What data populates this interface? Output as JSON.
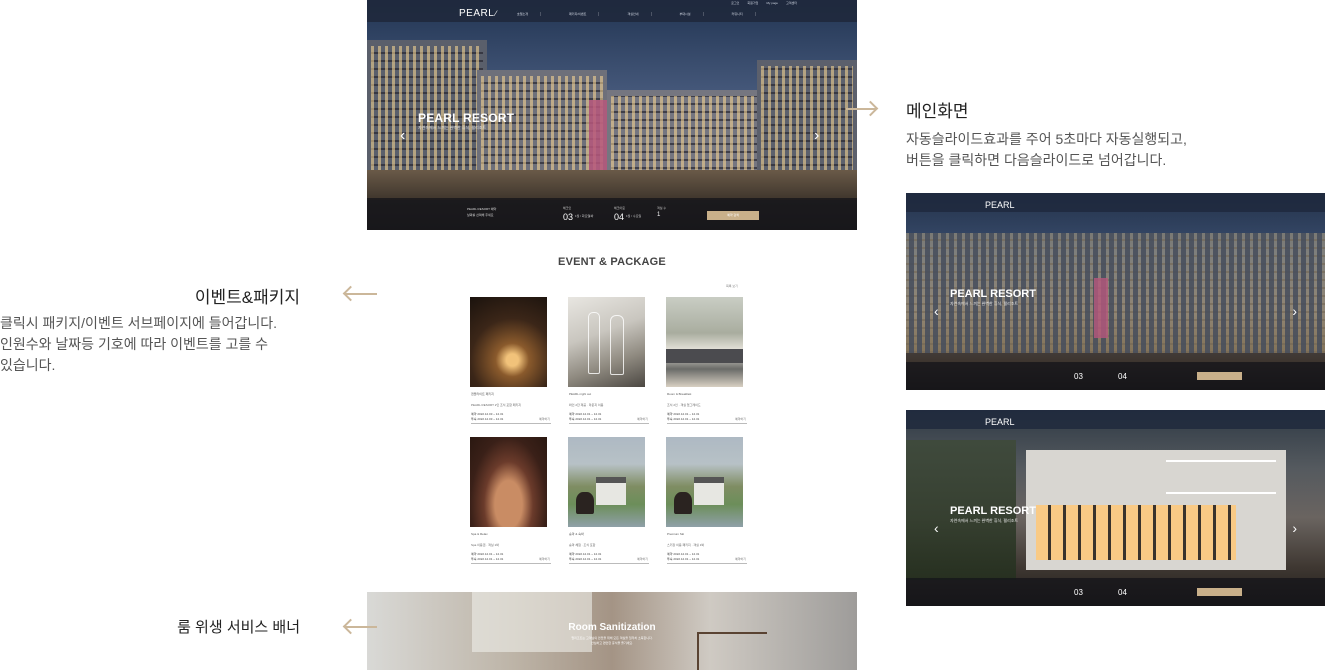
{
  "site": {
    "util_links": [
      "로그인",
      "회원가입",
      "My page",
      "고객센터"
    ],
    "logo": "PEARL",
    "gnb": [
      "호텔소개",
      "패키지/이벤트",
      "객실안내",
      "부대시설",
      "커뮤니티"
    ],
    "hero": {
      "title": "PEARL RESORT",
      "subtitle": "자연속에서 느끼는 완벽한 휴식, 펄리조트",
      "prev": "‹",
      "next": "›"
    },
    "booking": {
      "info_line1": "PEARL RESORT 예약",
      "info_line2": "날짜를 선택해 주세요",
      "checkin_label": "체크인",
      "checkin_day": "03",
      "checkin_meta": "1월 / 화요일",
      "nights": "1박",
      "checkout_label": "체크아웃",
      "checkout_day": "04",
      "checkout_meta": "1월 / 수요일",
      "guest_label": "객실 수",
      "guests": "1",
      "search_button": "예약 검색"
    },
    "events": {
      "title": "EVENT & PACKAGE",
      "more": "목록 보기",
      "cards": [
        {
          "name": "캔들라이트 패키지",
          "desc": "PEARL RESORT 2인 조식 포함 패키지",
          "period1": "예약 2022.12.03 ~ 12.31",
          "period2": "투숙 2022.12.03 ~ 12.31",
          "more": "예약하기"
        },
        {
          "name": "PEARL night out",
          "desc": "와인 2잔 제공 · 라운지 이용",
          "period1": "예약 2022.12.01 ~ 12.31",
          "period2": "투숙 2022.12.01 ~ 12.31",
          "more": "예약하기"
        },
        {
          "name": "Room & Breakfast",
          "desc": "조식 2인 · 객실 업그레이드",
          "period1": "예약 2022.12.01 ~ 12.31",
          "period2": "투숙 2022.12.01 ~ 12.31",
          "more": "예약하기"
        },
        {
          "name": "Spa & Relax",
          "desc": "Spa 이용권 · 객실 1박",
          "period1": "예약 2022.12.01 ~ 12.31",
          "period2": "투숙 2022.12.01 ~ 12.31",
          "more": "예약하기"
        },
        {
          "name": "승마 & 숙박",
          "desc": "승마 체험 · 조식 포함",
          "period1": "예약 2022.12.01 ~ 12.31",
          "period2": "투숙 2022.12.01 ~ 12.31",
          "more": "예약하기"
        },
        {
          "name": "Premium Ski",
          "desc": "스키장 이용 패키지 · 객실 1박",
          "period1": "예약 2022.12.01 ~ 12.31",
          "period2": "투숙 2022.12.01 ~ 12.31",
          "more": "예약하기"
        }
      ]
    },
    "sanitization": {
      "title": "Room Sanitization",
      "line1": "펄리조트는 고객님의 안전을 위해 모든 객실을 철저히 소독합니다.",
      "line2": "안심하고 편안한 휴식을 즐기세요."
    }
  },
  "annotations": {
    "main": {
      "heading": "메인화면",
      "line1": "자동슬라이드효과를 주어 5초마다 자동실행되고,",
      "line2": "버튼을 클릭하면 다음슬라이드로 넘어갑니다."
    },
    "event": {
      "heading": "이벤트&패키지",
      "line1": "클릭시 패키지/이벤트 서브페이지에 들어갑니다.",
      "line2": "인원수와 날짜등 기호에 따라 이벤트를 고를 수",
      "line3": "있습니다."
    },
    "banner": {
      "heading": "룸 위생 서비스 배너"
    }
  },
  "preview": {
    "slide1": {
      "logo": "PEARL",
      "title": "PEARL RESORT",
      "subtitle": "자연속에서 느끼는 완벽한 휴식, 펄리조트",
      "checkin_day": "03",
      "checkout_day": "04"
    },
    "slide2": {
      "logo": "PEARL",
      "title": "PEARL RESORT",
      "subtitle": "자연속에서 느끼는 완벽한 휴식, 펄리조트",
      "checkin_day": "03",
      "checkout_day": "04"
    }
  },
  "colors": {
    "accent": "#cbb79a",
    "button": "#c9b08a",
    "topbar": "#1e283c"
  }
}
